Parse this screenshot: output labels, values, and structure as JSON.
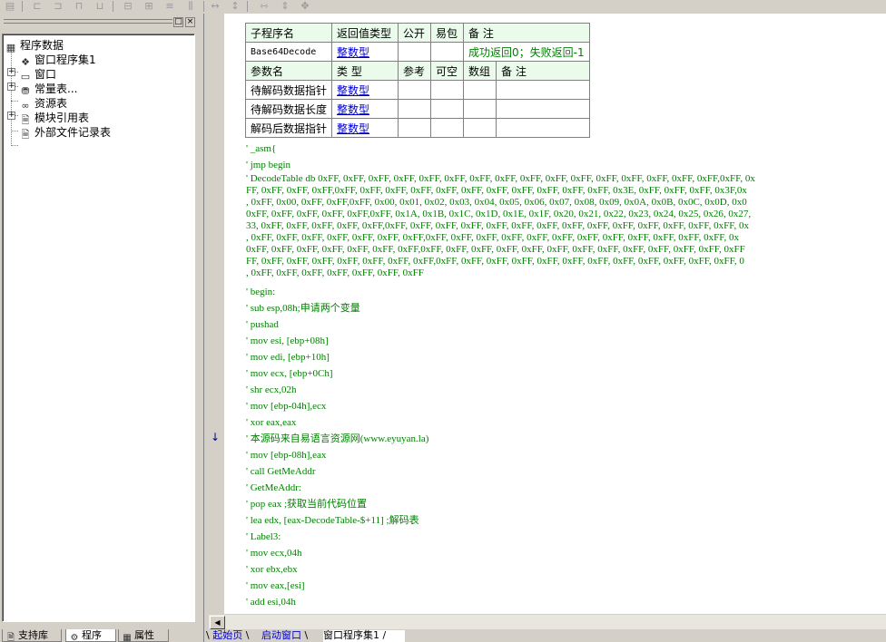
{
  "toolbar": {
    "icons": [
      "save-icon",
      "align-left-icon",
      "align-right-icon",
      "align-top-icon",
      "align-bottom-icon",
      "center-horizontal-icon",
      "center-vertical-icon",
      "distribute-icon",
      "same-width-icon",
      "same-height-icon",
      "same-size-icon"
    ]
  },
  "left_panel": {
    "minimize_label": "□",
    "close_label": "×",
    "tree": {
      "root": "程序数据",
      "items": [
        "窗口程序集1",
        "窗口",
        "常量表...",
        "资源表",
        "模块引用表",
        "外部文件记录表"
      ]
    },
    "tabs": [
      "支持库",
      "程序",
      "属性"
    ]
  },
  "subroutine": {
    "header": [
      "子程序名",
      "返回值类型",
      "公开",
      "易包",
      "备 注"
    ],
    "name": "Base64Decode",
    "return_type": "整数型",
    "public": "",
    "package": "",
    "note": "成功返回0；失败返回-1"
  },
  "params": {
    "header": [
      "参数名",
      "类 型",
      "参考",
      "可空",
      "数组",
      "备 注"
    ],
    "rows": [
      {
        "name": "待解码数据指针",
        "type": "整数型"
      },
      {
        "name": "待解码数据长度",
        "type": "整数型"
      },
      {
        "name": "解码后数据指针",
        "type": "整数型"
      }
    ]
  },
  "code": {
    "lines_top": [
      "' _asm{",
      "' jmp begin"
    ],
    "decode_table": "' DecodeTable db 0xFF, 0xFF, 0xFF, 0xFF, 0xFF, 0xFF, 0xFF, 0xFF, 0xFF, 0xFF, 0xFF, 0xFF, 0xFF, 0xFF, 0xFF, 0xFF,0xFF, 0x\nFF, 0xFF, 0xFF, 0xFF,0xFF, 0xFF, 0xFF, 0xFF, 0xFF, 0xFF, 0xFF, 0xFF, 0xFF, 0xFF, 0xFF, 0x3E, 0xFF, 0xFF, 0xFF, 0x3F,0x\n, 0xFF, 0x00, 0xFF, 0xFF,0xFF, 0x00, 0x01, 0x02, 0x03, 0x04, 0x05, 0x06, 0x07, 0x08, 0x09, 0x0A, 0x0B, 0x0C, 0x0D, 0x0\n0xFF, 0xFF, 0xFF, 0xFF, 0xFF,0xFF, 0x1A, 0x1B, 0x1C, 0x1D, 0x1E, 0x1F, 0x20, 0x21, 0x22, 0x23, 0x24, 0x25, 0x26, 0x27,\n33, 0xFF, 0xFF, 0xFF, 0xFF, 0xFF,0xFF, 0xFF, 0xFF, 0xFF, 0xFF, 0xFF, 0xFF, 0xFF, 0xFF, 0xFF, 0xFF, 0xFF, 0xFF, 0xFF, 0x\n, 0xFF, 0xFF, 0xFF, 0xFF, 0xFF, 0xFF, 0xFF,0xFF, 0xFF, 0xFF, 0xFF, 0xFF, 0xFF, 0xFF, 0xFF, 0xFF, 0xFF, 0xFF, 0xFF, 0x\n0xFF, 0xFF, 0xFF, 0xFF, 0xFF, 0xFF, 0xFF,0xFF, 0xFF, 0xFF, 0xFF, 0xFF, 0xFF, 0xFF, 0xFF, 0xFF, 0xFF, 0xFF, 0xFF, 0xFF\nFF, 0xFF, 0xFF, 0xFF, 0xFF, 0xFF, 0xFF, 0xFF,0xFF, 0xFF, 0xFF, 0xFF, 0xFF, 0xFF, 0xFF, 0xFF, 0xFF, 0xFF, 0xFF, 0xFF, 0\n, 0xFF, 0xFF, 0xFF, 0xFF, 0xFF, 0xFF, 0xFF",
    "lines_bottom": [
      "' begin:",
      "' sub esp,08h;申请两个变量",
      "' pushad",
      "' mov esi, [ebp+08h]",
      "' mov edi, [ebp+10h]",
      "' mov ecx, [ebp+0Ch]",
      "' shr ecx,02h",
      "' mov [ebp-04h],ecx",
      "' xor eax,eax",
      "' 本源码来自易语言资源网(www.eyuyan.la)",
      "' mov [ebp-08h],eax",
      "' call GetMeAddr",
      "' GetMeAddr:",
      "' pop eax ;获取当前代码位置",
      "' lea edx, [eax-DecodeTable-$+11] ;解码表",
      "' Label3:",
      "' mov ecx,04h",
      "' xor ebx,ebx",
      "' mov eax,[esi]",
      "' add esi,04h"
    ]
  },
  "scrollbar": {
    "left_arrow": "◀"
  },
  "gutter": {
    "arrow": "↓"
  },
  "bottom_tabs": [
    "起始页",
    "启动窗口",
    "窗口程序集1"
  ]
}
